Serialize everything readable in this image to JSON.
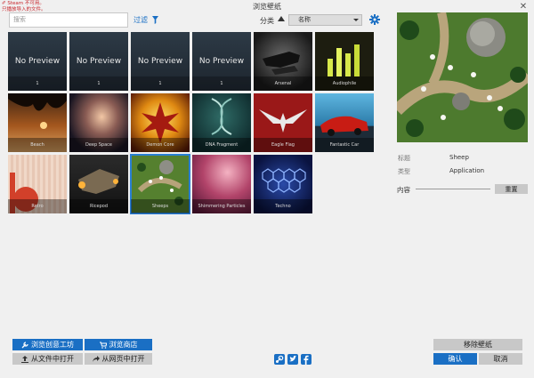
{
  "window": {
    "title": "浏览壁纸",
    "notice_line1": "✐ Steam 不可用。",
    "notice_line2": "只播放导入的文件。",
    "close": "✕"
  },
  "toolbar": {
    "search_placeholder": "搜索",
    "filter_label": "过滤",
    "sort_label": "分类",
    "sort_value": "名称",
    "icons": {
      "filter": "funnel-icon",
      "sort": "sort-ascending-icon",
      "settings": "gear-icon"
    }
  },
  "wallpapers": [
    {
      "title": "No Preview",
      "caption": "1"
    },
    {
      "title": "No Preview",
      "caption": "1"
    },
    {
      "title": "No Preview",
      "caption": "1"
    },
    {
      "title": "No Preview",
      "caption": "1"
    },
    {
      "title": "",
      "caption": "Arsenal"
    },
    {
      "title": "",
      "caption": "Audiophile"
    },
    {
      "title": "",
      "caption": "Beach"
    },
    {
      "title": "",
      "caption": "Deep Space"
    },
    {
      "title": "",
      "caption": "Demon Core"
    },
    {
      "title": "",
      "caption": "DNA Fragment"
    },
    {
      "title": "",
      "caption": "Eagle Flag"
    },
    {
      "title": "",
      "caption": "Fantastic Car"
    },
    {
      "title": "",
      "caption": "Retro"
    },
    {
      "title": "",
      "caption": "Ricepod"
    },
    {
      "title": "",
      "caption": "Sheeps"
    },
    {
      "title": "",
      "caption": "Shimmering Particles"
    },
    {
      "title": "",
      "caption": "Techno"
    }
  ],
  "selected_index": 14,
  "details": {
    "title_label": "标题",
    "title_value": "Sheep",
    "type_label": "类型",
    "type_value": "Application",
    "content_label": "内容",
    "reset_label": "重置"
  },
  "bottom": {
    "workshop": "浏览创意工坊",
    "store": "浏览商店",
    "open_file": "从文件中打开",
    "open_web": "从网页中打开",
    "remove": "移除壁纸",
    "ok": "确认",
    "cancel": "取消",
    "social": [
      "steam-icon",
      "twitter-icon",
      "facebook-icon"
    ]
  },
  "colors": {
    "accent": "#1a6fc4",
    "notice": "#c8262c"
  }
}
